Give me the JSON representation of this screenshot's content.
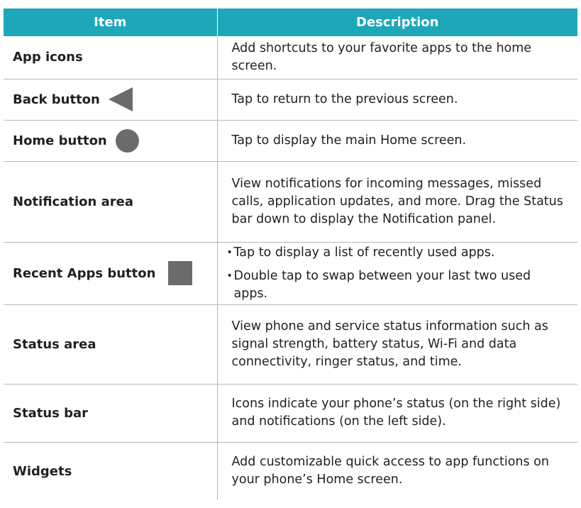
{
  "table": {
    "headers": [
      "Item",
      "Description"
    ],
    "rows": [
      {
        "item": "App icons",
        "icon": "",
        "description": "Add shortcuts to your favorite apps to the home screen."
      },
      {
        "item": "Back button",
        "icon": "back-triangle-icon",
        "description": "Tap to return to the previous screen."
      },
      {
        "item": "Home button",
        "icon": "home-circle-icon",
        "description": "Tap to display the main Home screen."
      },
      {
        "item": "Notification area",
        "icon": "",
        "description": "View notifications for incoming messages, missed calls, application updates, and more. Drag the Status bar down to display the Notification panel."
      },
      {
        "item": "Recent Apps button",
        "icon": "recent-square-icon",
        "bullets": [
          "Tap to display a list of recently used apps.",
          "Double tap to swap between your last two used apps."
        ]
      },
      {
        "item": "Status area",
        "icon": "",
        "description": "View phone and service status information such as signal strength, battery status, Wi-Fi and data connectivity, ringer status, and time."
      },
      {
        "item": "Status bar",
        "icon": "",
        "description": "Icons indicate your phone’s status (on the right side) and notifications (on the left side)."
      },
      {
        "item": "Widgets",
        "icon": "",
        "description": "Add customizable quick access to app functions on your phone’s Home screen."
      }
    ]
  },
  "colors": {
    "header_bg": "#1da7b9",
    "header_text": "#ffffff",
    "icon_gray": "#6b6b6b",
    "rule": "#b8b8b8"
  }
}
